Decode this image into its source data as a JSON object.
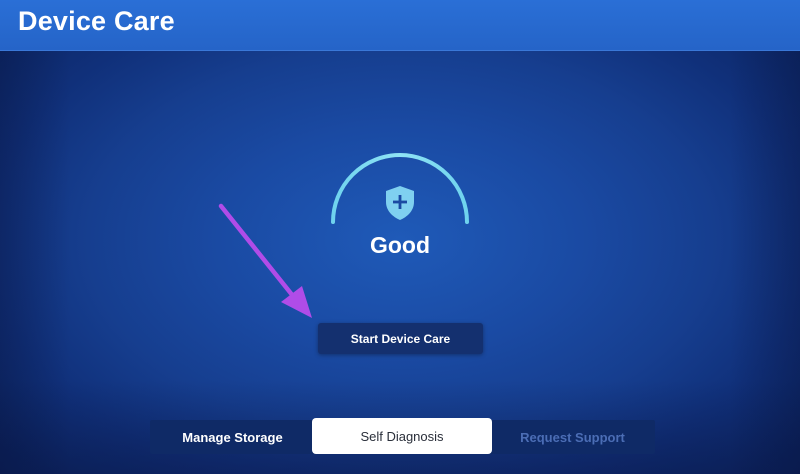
{
  "header": {
    "title": "Device Care"
  },
  "status": {
    "label": "Good",
    "icon": "shield-plus-icon"
  },
  "actions": {
    "start_label": "Start Device Care"
  },
  "tabs": [
    {
      "label": "Manage Storage",
      "state": "normal"
    },
    {
      "label": "Self Diagnosis",
      "state": "focused"
    },
    {
      "label": "Request Support",
      "state": "dimmed"
    }
  ],
  "colors": {
    "background": "#1a4aa3",
    "title_bar": "#2a6fd6",
    "gauge_arc": "#7fd8f0",
    "button": "#14306f",
    "focused_tab": "#ffffff",
    "annotation_arrow": "#b04ce8"
  }
}
